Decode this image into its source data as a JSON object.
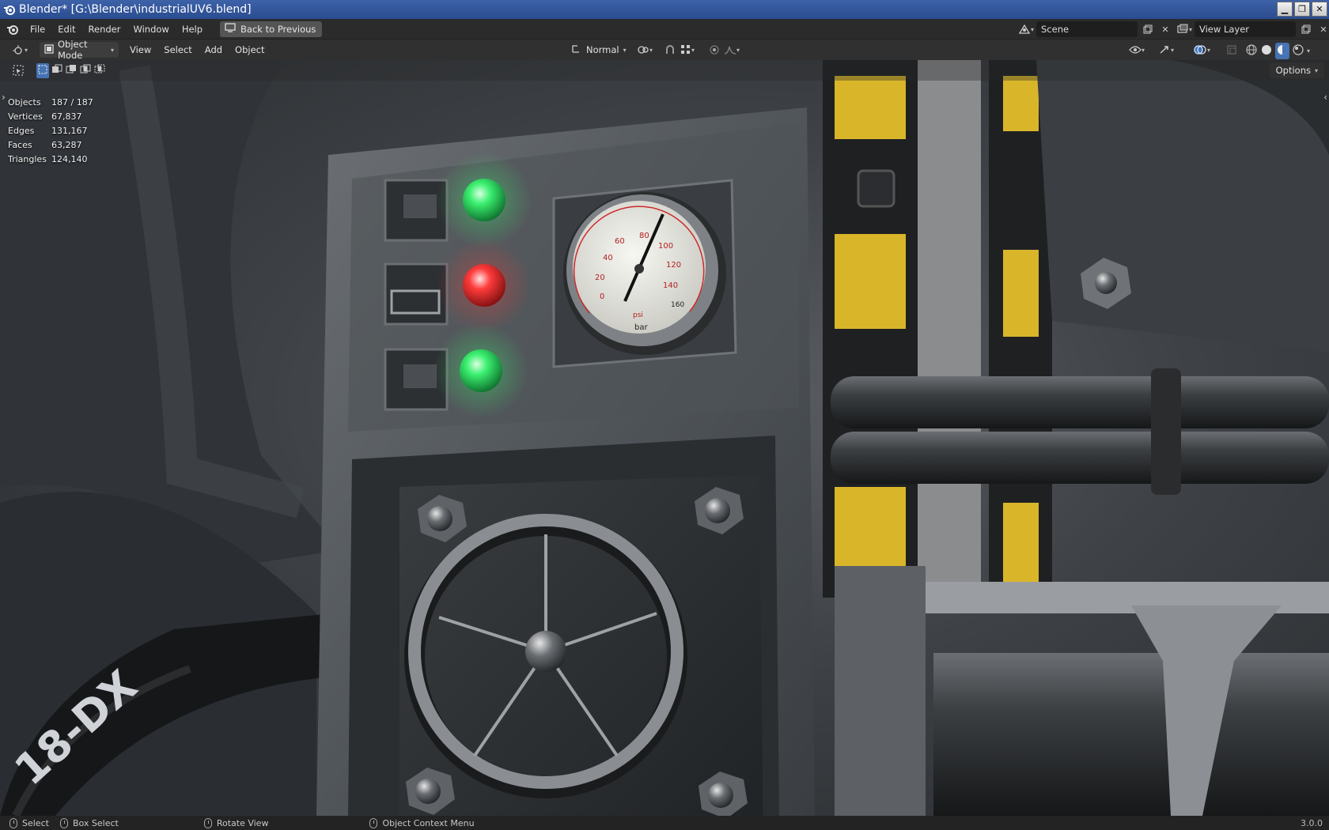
{
  "window": {
    "title": "Blender* [G:\\Blender\\industrialUV6.blend]",
    "controls": [
      "minimize",
      "restore",
      "close"
    ]
  },
  "menubar": {
    "items": [
      "File",
      "Edit",
      "Render",
      "Window",
      "Help"
    ],
    "back_button": "Back to Previous",
    "scene": "Scene",
    "view_layer": "View Layer"
  },
  "header": {
    "mode": "Object Mode",
    "menus": [
      "View",
      "Select",
      "Add",
      "Object"
    ],
    "orientation": "Normal",
    "options_label": "Options"
  },
  "stats": [
    {
      "label": "Objects",
      "value": "187 / 187"
    },
    {
      "label": "Vertices",
      "value": "67,837"
    },
    {
      "label": "Edges",
      "value": "131,167"
    },
    {
      "label": "Faces",
      "value": "63,287"
    },
    {
      "label": "Triangles",
      "value": "124,140"
    }
  ],
  "statusbar": {
    "select": "Select",
    "box_select": "Box Select",
    "rotate_view": "Rotate View",
    "context_menu": "Object Context Menu",
    "version": "3.0.0"
  },
  "scene_labels": {
    "gauge_units": "bar",
    "gauge_unit2": "psi",
    "gauge_ticks": [
      "0",
      "20",
      "40",
      "60",
      "80",
      "100",
      "120",
      "140",
      "160"
    ],
    "tyre_text": "18-DX"
  },
  "colors": {
    "light_green": "#3bf070",
    "light_red": "#ff3b3b",
    "hazard_yellow": "#d9b52a",
    "metal": "#55595d"
  }
}
